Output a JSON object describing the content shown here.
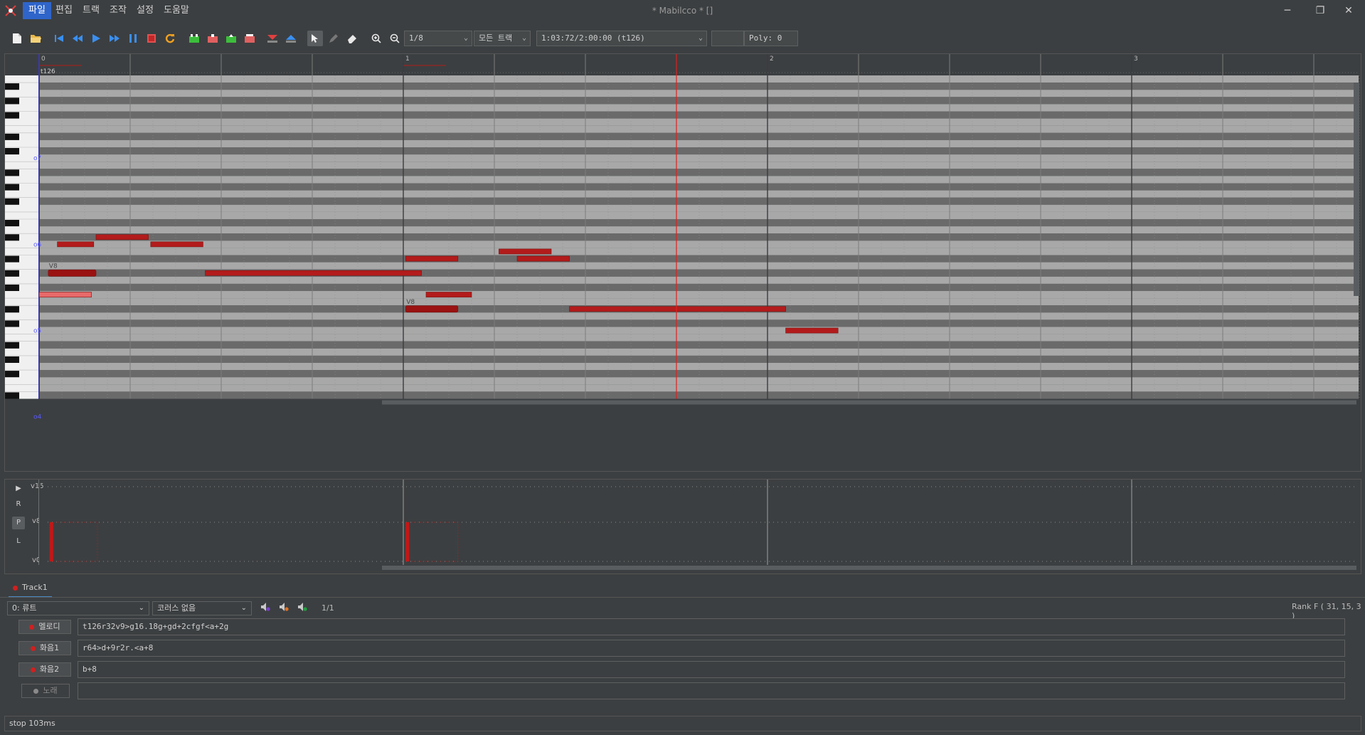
{
  "window": {
    "title": "* Mabilcco *  []",
    "controls": [
      "─",
      "❐",
      "✕"
    ]
  },
  "menu": [
    "파일",
    "편집",
    "트랙",
    "조작",
    "설정",
    "도움말"
  ],
  "toolbar": {
    "note_length": "1/8",
    "track_filter": "모든 트랙",
    "position": "1:03:72/2:00:00 (t126)",
    "blank_field": "",
    "poly": "Poly:  0"
  },
  "piano_roll": {
    "bar_numbers": [
      "0",
      "1",
      "2",
      "3"
    ],
    "tempo_label": "t126",
    "octave_labels": [
      "o7",
      "o6",
      "o5",
      "o4"
    ],
    "velocity_markers": [
      "V8",
      "V8"
    ]
  },
  "velocity_panel": {
    "side_buttons": [
      "▶",
      "R",
      "P",
      "L"
    ],
    "labels": [
      "v15",
      "v8",
      "v0"
    ]
  },
  "track": {
    "tab_label": "Track1",
    "instrument": "0: 류트",
    "chorus": "코러스 없음",
    "page": "1/1",
    "rank": "Rank F ( 31, 15, 3 )",
    "parts": [
      {
        "label": "멜로디",
        "mml": "t126r32v9>g16.18g+gd+2cfgf<a+2g"
      },
      {
        "label": "화음1",
        "mml": "r64>d+9r2r.<a+8"
      },
      {
        "label": "화음2",
        "mml": "b+8"
      },
      {
        "label": "노래",
        "mml": ""
      }
    ]
  },
  "status": "stop 103ms",
  "colors": {
    "note": "#b31b1b",
    "note_selected": "#e86a6a",
    "playhead": "#e02020",
    "accent": "#2f65ca"
  }
}
